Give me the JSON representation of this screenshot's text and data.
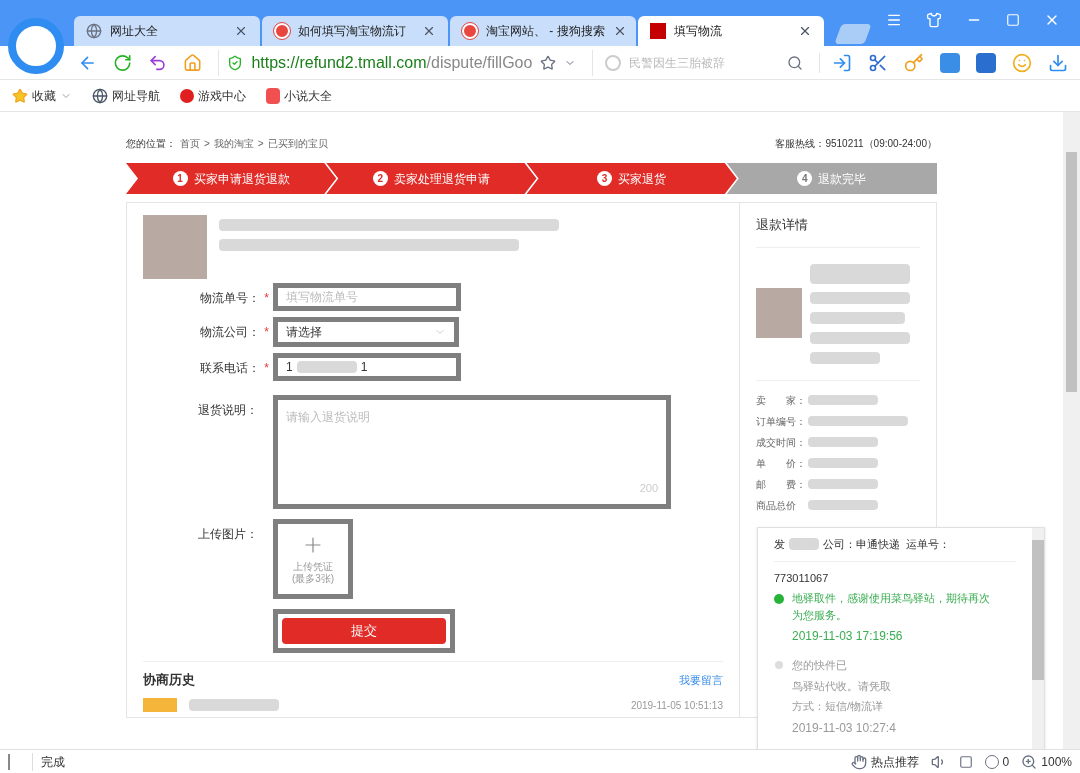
{
  "browser": {
    "tabs": [
      {
        "label": "网址大全",
        "selected": false
      },
      {
        "label": "如何填写淘宝物流订",
        "selected": false
      },
      {
        "label": "淘宝网站、 - 搜狗搜索",
        "selected": false
      },
      {
        "label": "填写物流",
        "selected": true
      }
    ],
    "address": {
      "host": "https://refund2.tmall.com",
      "path": "/dispute/fillGoo"
    },
    "search": {
      "placeholder": "民警因生三胎被辞"
    },
    "bookmarks": [
      {
        "label": "收藏"
      },
      {
        "label": "网址导航"
      },
      {
        "label": "游戏中心"
      },
      {
        "label": "小说大全"
      }
    ]
  },
  "page": {
    "breadcrumb": {
      "label": "您的位置：",
      "items": [
        "首页",
        "我的淘宝",
        "已买到的宝贝"
      ],
      "separator": ">"
    },
    "hotline": "客服热线：9510211（09:00-24:00）",
    "steps": [
      {
        "number": "1",
        "label": "买家申请退货退款",
        "done": true
      },
      {
        "number": "2",
        "label": "卖家处理退货申请",
        "done": true
      },
      {
        "number": "3",
        "label": "买家退货",
        "done": true
      },
      {
        "number": "4",
        "label": "退款完毕",
        "done": false
      }
    ],
    "form": {
      "fields": [
        {
          "kind": "input",
          "label": "物流单号：",
          "mark": "*",
          "placeholder": "填写物流单号"
        },
        {
          "kind": "select",
          "label": "物流公司：",
          "mark": "*",
          "value": "请选择"
        },
        {
          "kind": "masked",
          "label": "联系电话：",
          "mark": "*",
          "value": "1",
          "value_end": "1"
        },
        {
          "kind": "textarea",
          "label": "退货说明：",
          "placeholder": "请输入退货说明",
          "counter": "200"
        },
        {
          "kind": "upload",
          "label": "上传图片：",
          "lines": [
            "上传凭证",
            "(最多3张)"
          ]
        }
      ],
      "submit": "提交"
    },
    "history": {
      "title": "协商历史",
      "link": "我要留言",
      "time": "2019-11-05 10:51:13"
    },
    "refund_details": {
      "title": "退款详情",
      "rows": [
        "卖　　家：",
        "订单编号：",
        "成交时间：",
        "单　　价：",
        "邮　　费：",
        "商品总价"
      ]
    },
    "tracking": {
      "header": "发",
      "header_rest": "公司：申通快递  运单号：",
      "number": "773011067",
      "events": [
        {
          "latest": true,
          "text": "地驿取件，感谢使用菜鸟驿站，期待再次为您服务。",
          "time": "2019-11-03 17:19:56"
        },
        {
          "latest": false,
          "lines": [
            "您的快件已",
            "鸟驿站代收。请凭取",
            "方式：短信/物流详"
          ],
          "time": "2019-11-03 10:27:4"
        }
      ]
    }
  },
  "status_bar": {
    "status": "完成",
    "hot": "热点推荐",
    "ad_count": "0",
    "zoom": "100%"
  }
}
